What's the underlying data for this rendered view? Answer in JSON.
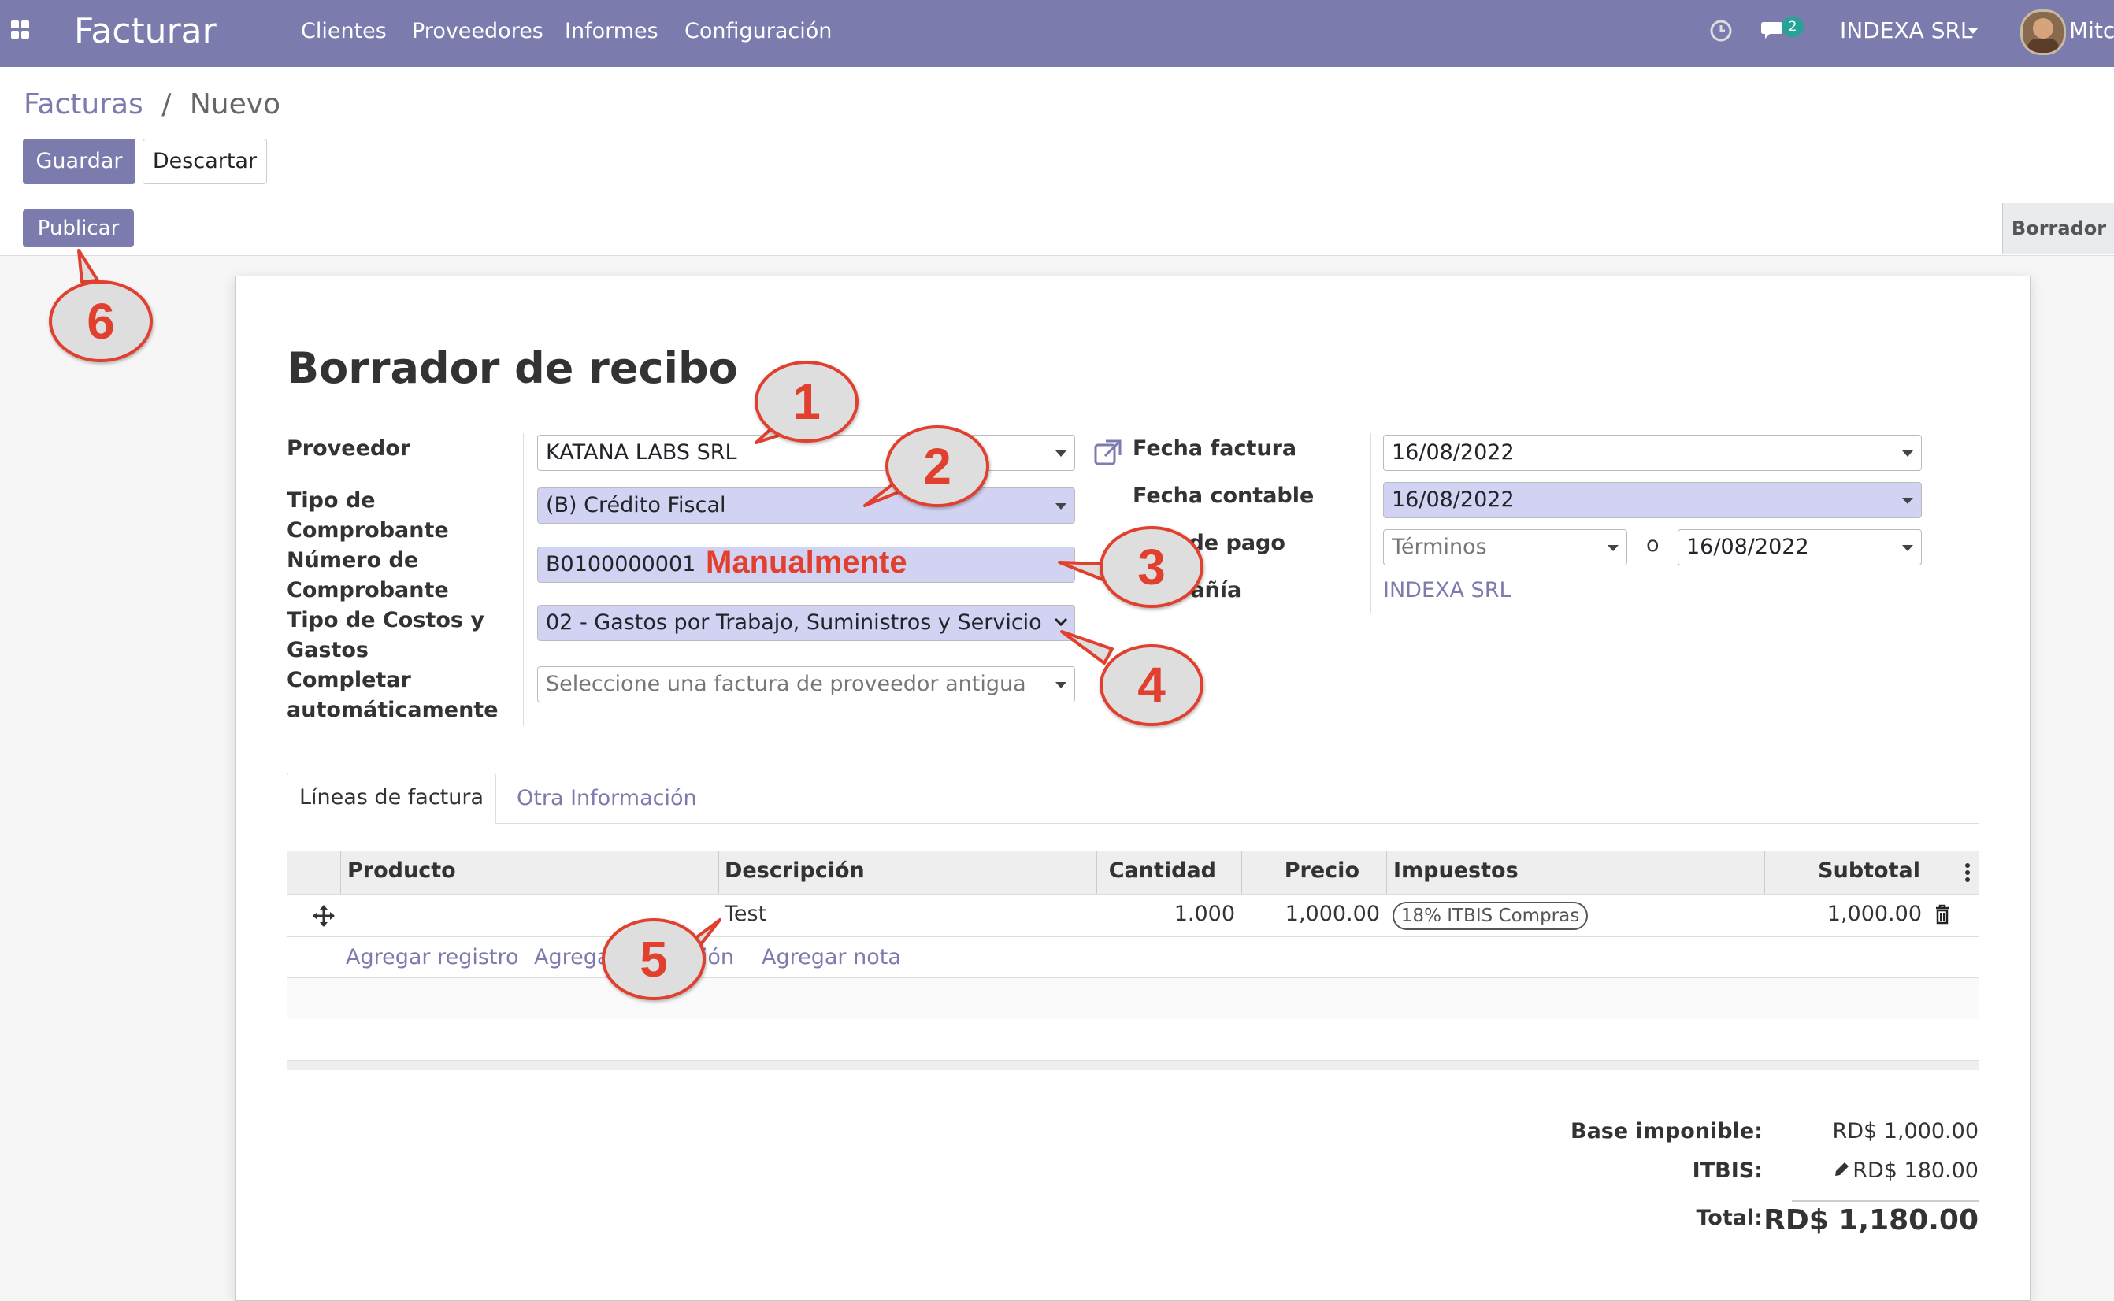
{
  "navbar": {
    "app_title": "Facturar",
    "menu": [
      "Clientes",
      "Proveedores",
      "Informes",
      "Configuración"
    ],
    "message_count": "2",
    "company": "INDEXA SRL",
    "user": "Mitcl"
  },
  "breadcrumb": {
    "parent": "Facturas",
    "separator": "/",
    "current": "Nuevo"
  },
  "buttons": {
    "save": "Guardar",
    "discard": "Descartar",
    "publish": "Publicar"
  },
  "status": "Borrador",
  "form": {
    "title": "Borrador de recibo",
    "labels": {
      "vendor": "Proveedor",
      "doc_type_1": "Tipo de",
      "doc_type_2": "Comprobante",
      "doc_number_1": "Número de",
      "doc_number_2": "Comprobante",
      "cost_type_1": "Tipo de Costos y",
      "cost_type_2": "Gastos",
      "autocomplete_1": "Completar",
      "autocomplete_2": "automáticamente",
      "invoice_date": "Fecha factura",
      "accounting_date": "Fecha contable",
      "payment_terms": "s de pago",
      "company": "pañía"
    },
    "values": {
      "vendor": "KATANA LABS SRL",
      "doc_type": "(B) Crédito Fiscal",
      "doc_number": "B0100000001",
      "cost_type": "02 - Gastos por Trabajo, Suministros y Servicio",
      "autocomplete_placeholder": "Seleccione una factura de proveedor antigua",
      "invoice_date": "16/08/2022",
      "accounting_date": "16/08/2022",
      "payment_terms": "Términos",
      "or": "o",
      "due_date": "16/08/2022",
      "company": "INDEXA SRL"
    }
  },
  "tabs": [
    "Líneas de factura",
    "Otra Información"
  ],
  "table": {
    "headers": [
      "Producto",
      "Descripción",
      "Cantidad",
      "Precio",
      "Impuestos",
      "Subtotal"
    ],
    "row": {
      "product": "",
      "description": "Test",
      "quantity": "1.000",
      "price": "1,000.00",
      "tax": "18% ITBIS Compras",
      "subtotal": "1,000.00"
    },
    "add_record": "Agregar registro",
    "add_section_fragment_1": "Agrega",
    "add_section_fragment_2": "ción",
    "add_note": "Agregar nota"
  },
  "totals": {
    "base_label": "Base imponible:",
    "base_value": "RD$ 1,000.00",
    "tax_label": "ITBIS:",
    "tax_value": "RD$ 180.00",
    "total_label": "Total:",
    "total_value": "RD$ 1,180.00"
  },
  "annotations": {
    "manual_note": "Manualmente",
    "callouts": [
      "1",
      "2",
      "3",
      "4",
      "5",
      "6"
    ],
    "color": "#e0402d"
  },
  "colors": {
    "brand": "#7c7bad",
    "required_field": "#d2d2f3",
    "badge": "#28a197"
  }
}
